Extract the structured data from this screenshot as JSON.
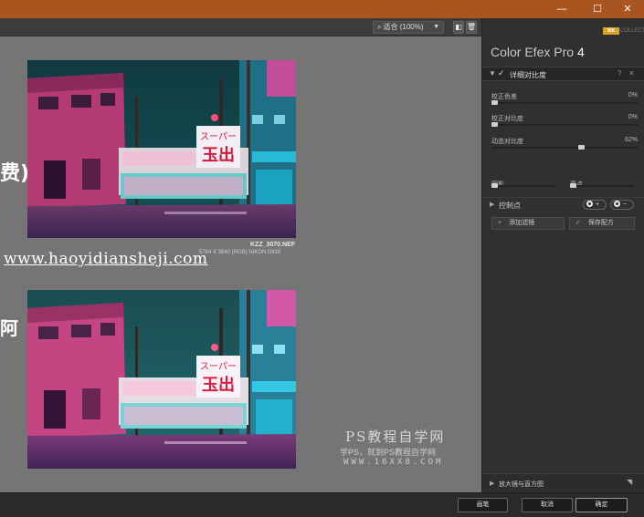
{
  "window": {
    "controls": {
      "minimize": "—",
      "maximize": "☐",
      "close": "✕"
    }
  },
  "toolbar": {
    "zoom_label": "适合 (100%)",
    "icons": [
      "view-split-icon",
      "trash-icon"
    ]
  },
  "canvas": {
    "file_name": "KZZ_3070.NEF",
    "file_meta": "5784 X 3840 (RGB) NIKON D810",
    "bg_text_1": "费)",
    "bg_text_2": "阿",
    "site_url": "www.haoyidiansheji.com",
    "watermark": {
      "title": "PS教程自学网",
      "subtitle": "学PS，就到PS教程自学网",
      "domain": "WWW.16XX8.COM"
    },
    "photo_top_sign": {
      "top": "スーパー",
      "main": "玉出"
    },
    "photo_bottom_sign": {
      "top": "スーパー",
      "main": "玉出"
    }
  },
  "panel": {
    "brand_badge": "NIK",
    "brand_text": "COLLECTION",
    "app_title": "Color Efex Pro",
    "app_version": "4",
    "filter": {
      "name": "详细对比度",
      "header_icons": [
        "?",
        "✕"
      ],
      "controls": [
        {
          "label": "校正色差",
          "value": "0%",
          "fraction": 0.0
        },
        {
          "label": "校正对比度",
          "value": "0%",
          "fraction": 0.0
        },
        {
          "label": "动态对比度",
          "value": "62%",
          "fraction": 0.62
        }
      ],
      "shadows_label": "阴影",
      "highlights_label": "亮点",
      "shadows_fraction": 0.0,
      "highlights_fraction": 0.0,
      "control_points_label": "控制点"
    },
    "add_filter_label": "添加滤镜",
    "save_recipe_label": "保存配方",
    "loupe_label": "放大镜与直方图"
  },
  "footer": {
    "brush_label": "画笔",
    "cancel_label": "取消",
    "ok_label": "确定"
  },
  "colors": {
    "title_bar": "#a95520",
    "canvas_bg": "#757575",
    "panel_bg": "#303030",
    "brand_gold": "#d9a326"
  }
}
